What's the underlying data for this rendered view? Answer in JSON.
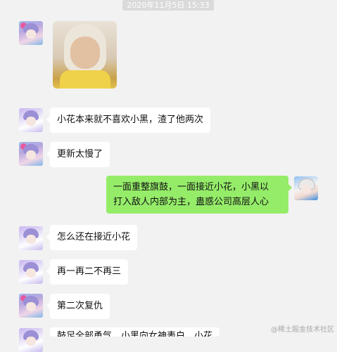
{
  "timestamp": "2020年11月5日 15:33",
  "messages": [
    {
      "side": "left",
      "avatar": "anime-girl-avatar",
      "type": "image",
      "image": "baby-photo"
    },
    {
      "side": "left",
      "avatar": "anime-girl-avatar",
      "type": "text",
      "text": "小花本来就不喜欢小黑，渣了他两次"
    },
    {
      "side": "left",
      "avatar": "anime-girl-avatar",
      "type": "text",
      "text": "更新太慢了"
    },
    {
      "side": "right",
      "avatar": "anime-boy-avatar",
      "type": "text",
      "line1": "一面重整旗鼓，一面接近小花，小黑以",
      "line2": "打入敌人内部为主，蛊惑公司高层人心"
    },
    {
      "side": "left",
      "avatar": "anime-girl-avatar",
      "type": "text",
      "text": "怎么还在接近小花"
    },
    {
      "side": "left",
      "avatar": "anime-girl-avatar",
      "type": "text",
      "text": "再一再二不再三"
    },
    {
      "side": "left",
      "avatar": "anime-girl-avatar",
      "type": "text",
      "text": "第二次复仇"
    },
    {
      "side": "left",
      "avatar": "anime-girl-avatar",
      "type": "text",
      "text": "鼓足全部勇气，小黑向女神表白，小花"
    }
  ],
  "watermark": "@稀土掘金技术社区"
}
